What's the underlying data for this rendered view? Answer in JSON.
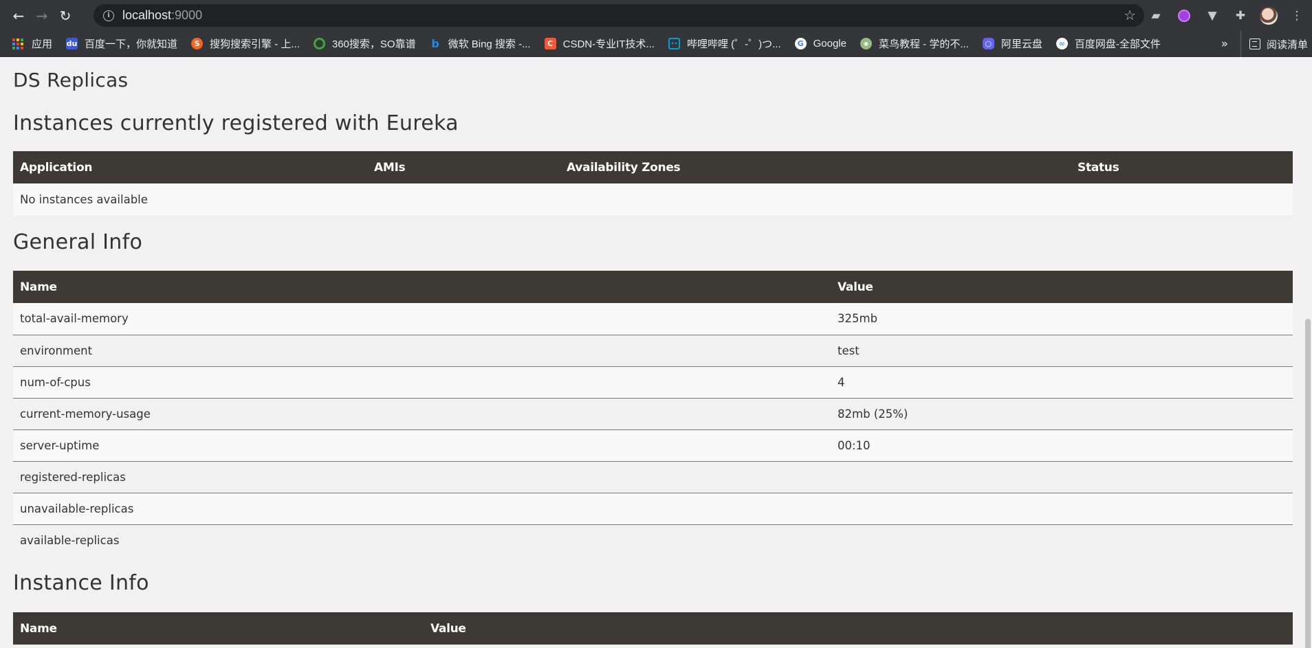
{
  "browser": {
    "url_host": "localhost",
    "url_port": ":9000",
    "bookmarks": [
      {
        "label": "应用",
        "icon": "apps-grid-icon"
      },
      {
        "label": "百度一下，你就知道",
        "icon": "baidu-icon",
        "color": "#3b58e2"
      },
      {
        "label": "搜狗搜索引擎 - 上...",
        "icon": "sogou-icon",
        "color": "#f26522"
      },
      {
        "label": "360搜索，SO靠谱",
        "icon": "360-icon",
        "color": "#3aaa35"
      },
      {
        "label": "微软 Bing 搜索 -...",
        "icon": "bing-icon",
        "color": "#1a8ce8"
      },
      {
        "label": "CSDN-专业IT技术...",
        "icon": "csdn-icon",
        "color": "#fc5531"
      },
      {
        "label": "哔哩哔哩 (゜-゜)つ...",
        "icon": "bilibili-icon",
        "color": "#00a1d6"
      },
      {
        "label": "Google",
        "icon": "google-icon",
        "color": "#ffffff"
      },
      {
        "label": "菜鸟教程 - 学的不...",
        "icon": "runoob-icon",
        "color": "#96b97d"
      },
      {
        "label": "阿里云盘",
        "icon": "aliyun-drive-icon",
        "color": "#6264f5"
      },
      {
        "label": "百度网盘-全部文件",
        "icon": "baidu-netdisk-icon",
        "color": "#2fa5f5"
      }
    ],
    "more_label": "»",
    "reading_list_label": "阅读清单"
  },
  "page": {
    "ds_replicas_title": "DS Replicas",
    "instances_title": "Instances currently registered with Eureka",
    "instances_table": {
      "headers": [
        "Application",
        "AMIs",
        "Availability Zones",
        "Status"
      ],
      "empty_message": "No instances available"
    },
    "general_info_title": "General Info",
    "general_info_table": {
      "headers": [
        "Name",
        "Value"
      ],
      "rows": [
        {
          "name": "total-avail-memory",
          "value": "325mb"
        },
        {
          "name": "environment",
          "value": "test"
        },
        {
          "name": "num-of-cpus",
          "value": "4"
        },
        {
          "name": "current-memory-usage",
          "value": "82mb (25%)"
        },
        {
          "name": "server-uptime",
          "value": "00:10"
        },
        {
          "name": "registered-replicas",
          "value": ""
        },
        {
          "name": "unavailable-replicas",
          "value": ""
        },
        {
          "name": "available-replicas",
          "value": ""
        }
      ]
    },
    "instance_info_title": "Instance Info",
    "instance_info_table": {
      "headers": [
        "Name",
        "Value"
      ]
    }
  }
}
